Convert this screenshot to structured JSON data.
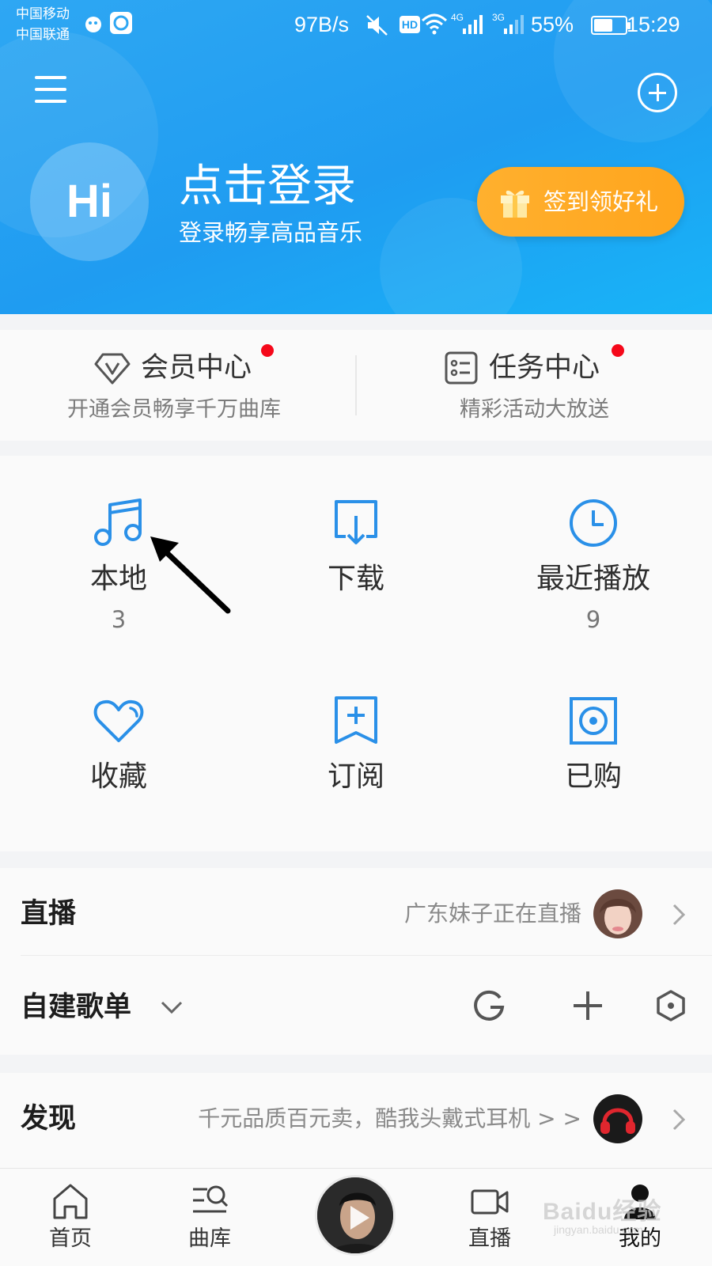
{
  "status_bar": {
    "carrier_1": "中国移动",
    "carrier_2": "中国联通",
    "net_speed": "97B/s",
    "hd": "HD",
    "net_4g": "4G",
    "net_3g": "3G",
    "battery": "55%",
    "time": "15:29"
  },
  "header": {
    "avatar_text": "Hi",
    "login_title": "点击登录",
    "login_subtitle": "登录畅享高品音乐",
    "signin_button": "签到领好礼"
  },
  "vip_card": {
    "member": {
      "title": "会员中心",
      "subtitle": "开通会员畅享千万曲库"
    },
    "task": {
      "title": "任务中心",
      "subtitle": "精彩活动大放送"
    }
  },
  "grid": {
    "items": [
      {
        "label": "本地",
        "count": "3",
        "icon": "music-note-icon"
      },
      {
        "label": "下载",
        "count": "",
        "icon": "download-icon"
      },
      {
        "label": "最近播放",
        "count": "9",
        "icon": "clock-icon"
      },
      {
        "label": "收藏",
        "count": "",
        "icon": "heart-icon"
      },
      {
        "label": "订阅",
        "count": "",
        "icon": "subscribe-icon"
      },
      {
        "label": "已购",
        "count": "",
        "icon": "purchased-icon"
      }
    ]
  },
  "live_row": {
    "title": "直播",
    "hint": "广东妹子正在直播"
  },
  "playlist_row": {
    "title": "自建歌单"
  },
  "discover_row": {
    "title": "发现",
    "hint": "千元品质百元卖，酷我头戴式耳机 > >"
  },
  "bottom_nav": {
    "items": [
      {
        "label": "首页"
      },
      {
        "label": "曲库"
      },
      {
        "label": "直播"
      },
      {
        "label": "我的"
      }
    ]
  },
  "watermark": {
    "text": "Baidu经验",
    "sub": "jingyan.baidu.com"
  },
  "colors": {
    "brand_blue": "#1f9cf1",
    "icon_blue": "#2a90e8",
    "accent_orange": "#ffa51d",
    "notify_red": "#f5081a"
  }
}
